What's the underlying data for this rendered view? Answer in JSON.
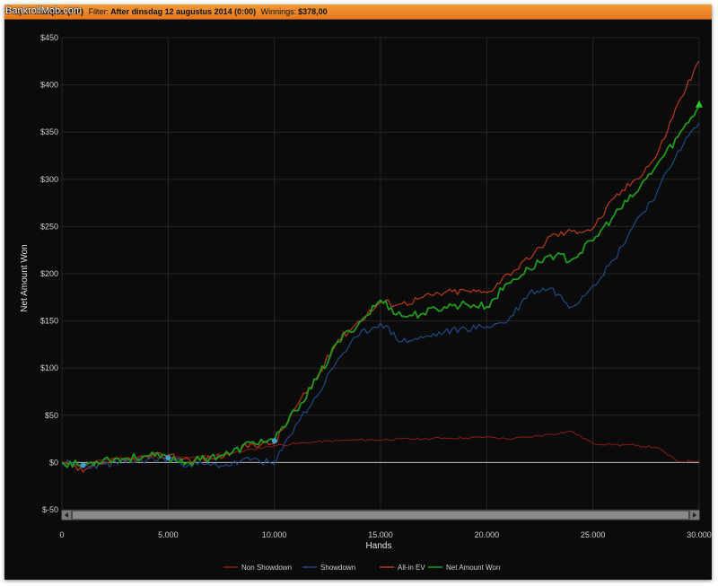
{
  "watermark": "BankrollMob.com",
  "header": {
    "player_label": "Player:",
    "player_value": "marqiss (PP)",
    "filter_label": "Filter:",
    "filter_value": "After dinsdag 12 augustus 2014 (0:00)",
    "winnings_label": "Winnings:",
    "winnings_value": "$378,00"
  },
  "colors": {
    "non_showdown": "#8b1c10",
    "showdown": "#1d4a86",
    "allin_ev": "#b83a1c",
    "net_won": "#1f9a1f",
    "grid": "#262626",
    "zero_line": "#bdbdbd",
    "background": "#0b0b0b",
    "header": "#e88a2a"
  },
  "chart_data": {
    "type": "line",
    "xlabel": "Hands",
    "ylabel": "Net Amount Won",
    "xlim": [
      0,
      30000
    ],
    "ylim": [
      -50,
      450
    ],
    "x_ticks": [
      0,
      5000,
      10000,
      15000,
      20000,
      25000,
      30000
    ],
    "x_tick_labels": [
      "0",
      "5.000",
      "10.000",
      "15.000",
      "20.000",
      "25.000",
      "30.000"
    ],
    "y_ticks": [
      -50,
      0,
      50,
      100,
      150,
      200,
      250,
      300,
      350,
      400,
      450
    ],
    "y_tick_labels": [
      "$-50",
      "$0",
      "$50",
      "$100",
      "$150",
      "$200",
      "$250",
      "$300",
      "$350",
      "$400",
      "$450"
    ],
    "grid": true,
    "legend_position": "bottom",
    "series": [
      {
        "name": "Non Showdown",
        "color_key": "non_showdown",
        "x": [
          0,
          1000,
          2000,
          3000,
          4000,
          5000,
          6000,
          7000,
          8000,
          9000,
          10000,
          11000,
          12000,
          13000,
          14000,
          15000,
          16000,
          17000,
          18000,
          19000,
          20000,
          21000,
          22000,
          23000,
          24000,
          25000,
          26000,
          27000,
          28000,
          29000,
          30000
        ],
        "y": [
          0,
          -2,
          3,
          5,
          6,
          6,
          5,
          7,
          10,
          14,
          18,
          20,
          22,
          23,
          24,
          24,
          25,
          25,
          26,
          26,
          27,
          25,
          27,
          30,
          33,
          20,
          19,
          18,
          16,
          1,
          2
        ]
      },
      {
        "name": "Showdown",
        "color_key": "showdown",
        "x": [
          0,
          1000,
          2000,
          3000,
          4000,
          5000,
          6000,
          7000,
          8000,
          9000,
          10000,
          11000,
          12000,
          13000,
          14000,
          15000,
          16000,
          17000,
          18000,
          19000,
          20000,
          21000,
          22000,
          23000,
          24000,
          25000,
          26000,
          27000,
          28000,
          29000,
          30000
        ],
        "y": [
          0,
          -4,
          -2,
          0,
          3,
          4,
          -2,
          -3,
          -2,
          4,
          -2,
          40,
          70,
          110,
          135,
          148,
          128,
          132,
          138,
          142,
          144,
          150,
          180,
          185,
          165,
          188,
          215,
          255,
          285,
          330,
          360
        ]
      },
      {
        "name": "All-in EV",
        "color_key": "allin_ev",
        "x": [
          0,
          1000,
          2000,
          3000,
          4000,
          5000,
          6000,
          7000,
          8000,
          9000,
          10000,
          11000,
          12000,
          13000,
          14000,
          15000,
          16000,
          17000,
          18000,
          19000,
          20000,
          21000,
          22000,
          23000,
          24000,
          25000,
          26000,
          27000,
          28000,
          29000,
          30000
        ],
        "y": [
          0,
          -10,
          0,
          2,
          6,
          8,
          3,
          4,
          10,
          20,
          20,
          58,
          90,
          130,
          150,
          170,
          168,
          175,
          180,
          182,
          180,
          200,
          215,
          240,
          245,
          248,
          280,
          300,
          325,
          380,
          425
        ]
      },
      {
        "name": "Net Amount Won",
        "color_key": "net_won",
        "x": [
          0,
          1000,
          2000,
          3000,
          4000,
          5000,
          6000,
          7000,
          8000,
          9000,
          10000,
          11000,
          12000,
          13000,
          14000,
          15000,
          16000,
          17000,
          18000,
          19000,
          20000,
          21000,
          22000,
          23000,
          24000,
          25000,
          26000,
          27000,
          28000,
          29000,
          30000
        ],
        "y": [
          0,
          -3,
          4,
          4,
          7,
          5,
          0,
          6,
          10,
          22,
          23,
          55,
          88,
          128,
          148,
          172,
          155,
          158,
          165,
          168,
          165,
          190,
          205,
          220,
          215,
          235,
          262,
          285,
          315,
          345,
          378
        ]
      }
    ],
    "markers": [
      {
        "x": 1000,
        "y": -3
      },
      {
        "x": 5000,
        "y": 5
      },
      {
        "x": 10000,
        "y": 23
      }
    ]
  }
}
